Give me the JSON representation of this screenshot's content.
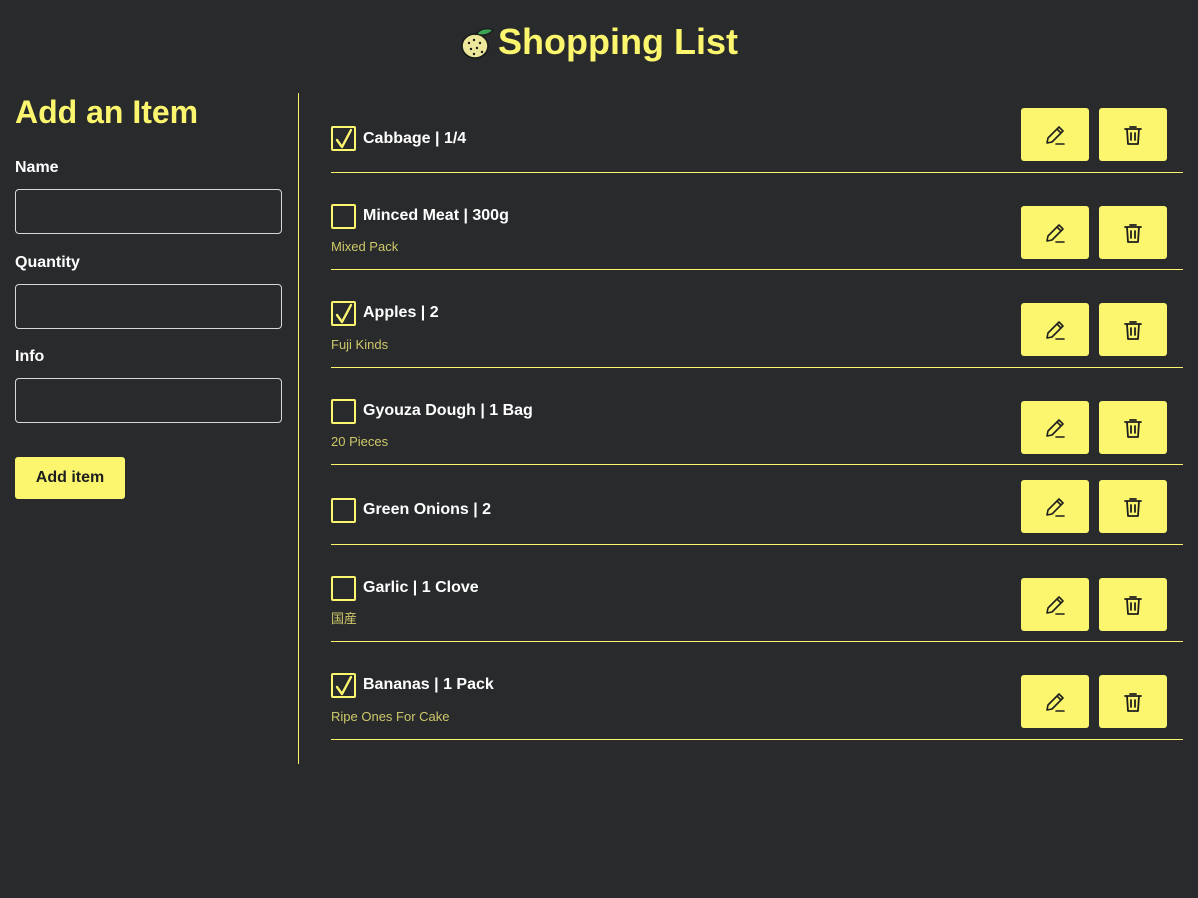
{
  "header": {
    "logo_icon": "citrus-fruit-icon",
    "title": "Shopping List"
  },
  "form": {
    "heading": "Add an Item",
    "name_label": "Name",
    "name_value": "",
    "quantity_label": "Quantity",
    "quantity_value": "",
    "info_label": "Info",
    "info_value": "",
    "submit_label": "Add item"
  },
  "items": [
    {
      "title": "Cabbage | 1/4",
      "info": "",
      "checked": true
    },
    {
      "title": "Minced Meat | 300g",
      "info": "Mixed Pack",
      "checked": false
    },
    {
      "title": "Apples | 2",
      "info": "Fuji Kinds",
      "checked": true
    },
    {
      "title": "Gyouza Dough | 1 Bag",
      "info": "20 Pieces",
      "checked": false
    },
    {
      "title": "Green Onions | 2",
      "info": "",
      "checked": false
    },
    {
      "title": "Garlic | 1 Clove",
      "info": "国産",
      "checked": false
    },
    {
      "title": "Bananas | 1 Pack",
      "info": "Ripe Ones For Cake",
      "checked": true
    }
  ],
  "icons": {
    "edit": "pencil-icon",
    "delete": "trash-icon",
    "check": "checkmark-icon"
  },
  "colors": {
    "background": "#282a2c",
    "accent": "#fbf66e",
    "info_text": "#cfc86a",
    "text": "#ffffff"
  }
}
